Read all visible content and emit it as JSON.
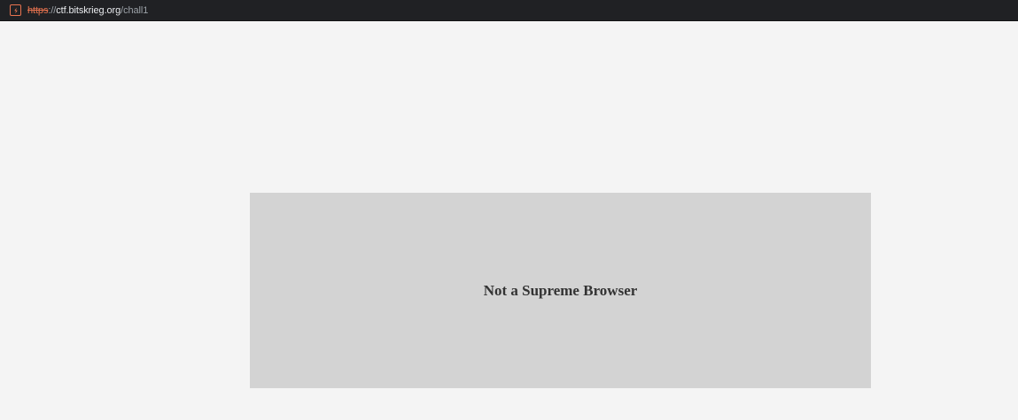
{
  "address_bar": {
    "security_icon": "not-secure-warning-icon",
    "url": {
      "scheme": "https",
      "separator": "://",
      "host": "ctf.bitskrieg.org",
      "path": "/chall1"
    }
  },
  "page": {
    "message": "Not a Supreme Browser"
  },
  "colors": {
    "toolbar_background": "#202124",
    "insecure_scheme": "#e8734f",
    "page_background": "#f4f4f4",
    "panel_background": "#d3d3d3",
    "message_text": "#333333"
  }
}
